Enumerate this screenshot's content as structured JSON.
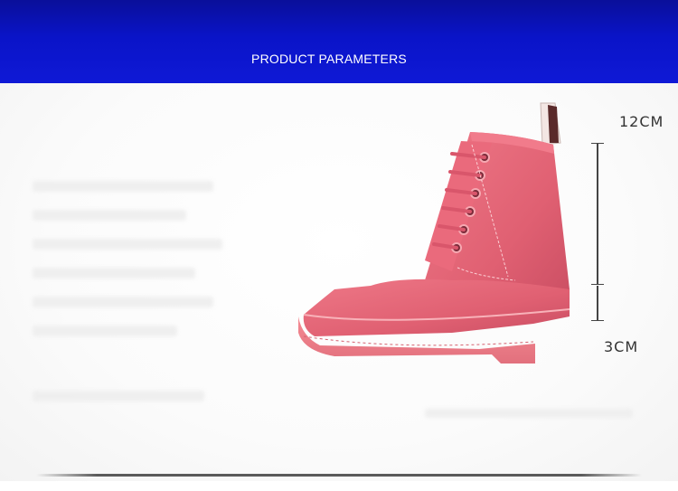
{
  "banner": {
    "title": "PRODUCT PARAMETERS"
  },
  "product": {
    "color": "#e46477"
  },
  "dimensions": {
    "shaft_label": "12CM",
    "heel_label": "3CM"
  }
}
